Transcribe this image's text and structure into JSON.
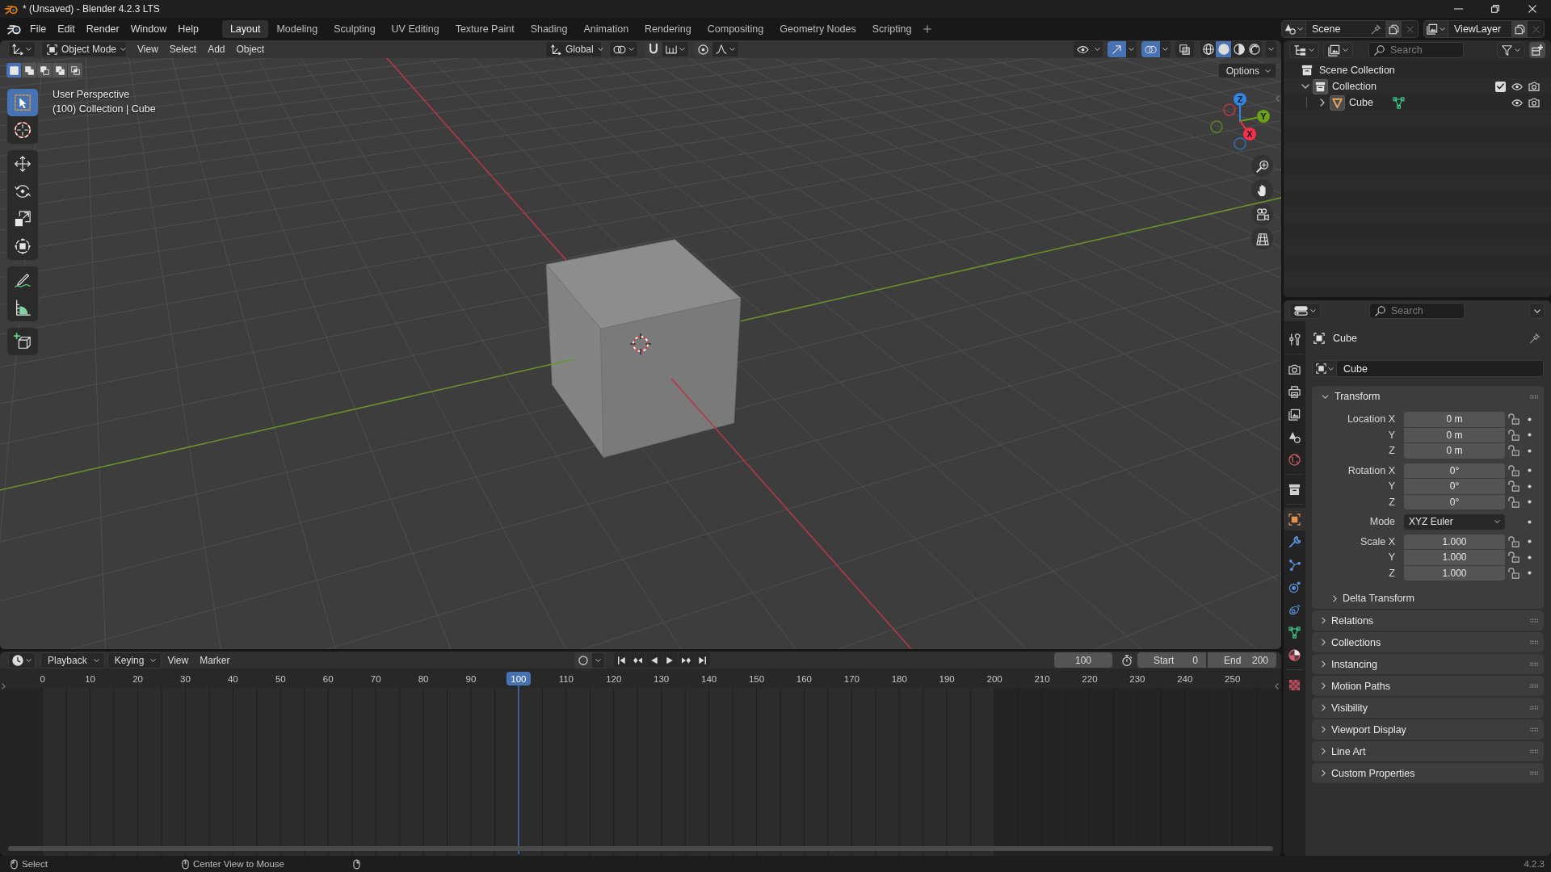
{
  "window": {
    "title": "* (Unsaved) - Blender 4.2.3 LTS"
  },
  "menu": [
    "File",
    "Edit",
    "Render",
    "Window",
    "Help"
  ],
  "workspaces": [
    {
      "label": "Layout",
      "selected": true
    },
    {
      "label": "Modeling",
      "selected": false
    },
    {
      "label": "Sculpting",
      "selected": false
    },
    {
      "label": "UV Editing",
      "selected": false
    },
    {
      "label": "Texture Paint",
      "selected": false
    },
    {
      "label": "Shading",
      "selected": false
    },
    {
      "label": "Animation",
      "selected": false
    },
    {
      "label": "Rendering",
      "selected": false
    },
    {
      "label": "Compositing",
      "selected": false
    },
    {
      "label": "Geometry Nodes",
      "selected": false
    },
    {
      "label": "Scripting",
      "selected": false
    }
  ],
  "scene": {
    "name": "Scene"
  },
  "view_layer": {
    "name": "ViewLayer"
  },
  "viewport": {
    "mode": "Object Mode",
    "menus": [
      "View",
      "Select",
      "Add",
      "Object"
    ],
    "orientation": "Global",
    "toggles": [
      {
        "kind": "selectability",
        "on": false
      },
      {
        "kind": "gizmos",
        "on": true
      },
      {
        "kind": "overlays",
        "on": true
      },
      {
        "kind": "xray",
        "on": false
      }
    ],
    "shading": [
      {
        "kind": "wireframe",
        "selected": false
      },
      {
        "kind": "solid",
        "selected": true
      },
      {
        "kind": "material",
        "selected": false
      },
      {
        "kind": "rendered",
        "selected": false
      }
    ],
    "select_modes": [
      {
        "kind": "set",
        "selected": true
      },
      {
        "kind": "extend",
        "selected": false
      },
      {
        "kind": "subtract",
        "selected": false
      },
      {
        "kind": "invert",
        "selected": false
      },
      {
        "kind": "intersect",
        "selected": false
      }
    ],
    "options": "Options",
    "info": [
      "User Perspective",
      "(100) Collection | Cube"
    ],
    "tool_groups": [
      {
        "tools": [
          {
            "kind": "select_box",
            "selected": true
          },
          {
            "kind": "cursor",
            "selected": false
          }
        ]
      },
      {
        "tools": [
          {
            "kind": "move",
            "selected": false
          },
          {
            "kind": "rotate",
            "selected": false
          },
          {
            "kind": "scale",
            "selected": false
          },
          {
            "kind": "transform",
            "selected": false
          }
        ]
      },
      {
        "tools": [
          {
            "kind": "annotate",
            "selected": false
          },
          {
            "kind": "measure",
            "selected": false
          }
        ]
      },
      {
        "tools": [
          {
            "kind": "add_cube",
            "selected": false
          }
        ]
      }
    ],
    "gizmo_axes": [
      {
        "label": "Z",
        "color": "#2f85e3"
      },
      {
        "label": "Y",
        "color": "#6ca11c"
      },
      {
        "label": "X",
        "color": "#f5304e"
      }
    ]
  },
  "outliner": {
    "search": {
      "placeholder": "Search"
    },
    "tree": [
      {
        "kind": "scene_collection",
        "label": "Scene Collection",
        "children": [
          {
            "kind": "collection",
            "label": "Collection",
            "expanded": true,
            "checked": true,
            "visible": true,
            "children": [
              {
                "kind": "object",
                "label": "Cube",
                "expanded": false,
                "visible": true
              }
            ]
          }
        ]
      }
    ]
  },
  "properties": {
    "search": {
      "placeholder": "Search"
    },
    "tab_groups": [
      {
        "tabs": [
          {
            "kind": "tool",
            "selected": false
          }
        ]
      },
      {
        "tabs": [
          {
            "kind": "render",
            "selected": false
          },
          {
            "kind": "output",
            "selected": false
          },
          {
            "kind": "view_layer",
            "selected": false
          },
          {
            "kind": "scene",
            "selected": false
          },
          {
            "kind": "world",
            "selected": false
          }
        ]
      },
      {
        "tabs": [
          {
            "kind": "collection",
            "selected": false
          }
        ]
      },
      {
        "tabs": [
          {
            "kind": "object",
            "selected": true
          },
          {
            "kind": "modifiers",
            "selected": false
          },
          {
            "kind": "particles",
            "selected": false
          },
          {
            "kind": "physics",
            "selected": false
          },
          {
            "kind": "constraints",
            "selected": false
          },
          {
            "kind": "data",
            "selected": false
          },
          {
            "kind": "material",
            "selected": false
          }
        ]
      },
      {
        "tabs": [
          {
            "kind": "texture",
            "selected": false
          }
        ]
      }
    ],
    "context": "Cube",
    "datablock": "Cube",
    "transform": {
      "title": "Transform",
      "expanded": true,
      "groups": [
        {
          "rows": [
            {
              "kind": "number",
              "label": "Location X",
              "value": "0 m",
              "locked": false
            },
            {
              "kind": "number",
              "label": "Y",
              "value": "0 m",
              "locked": false
            },
            {
              "kind": "number",
              "label": "Z",
              "value": "0 m",
              "locked": false
            }
          ]
        },
        {
          "rows": [
            {
              "kind": "number",
              "label": "Rotation X",
              "value": "0°",
              "locked": false
            },
            {
              "kind": "number",
              "label": "Y",
              "value": "0°",
              "locked": false
            },
            {
              "kind": "number",
              "label": "Z",
              "value": "0°",
              "locked": false
            }
          ]
        },
        {
          "rows": [
            {
              "kind": "dropdown",
              "label": "Mode",
              "value": "XYZ Euler"
            }
          ]
        },
        {
          "rows": [
            {
              "kind": "number",
              "label": "Scale X",
              "value": "1.000",
              "locked": false
            },
            {
              "kind": "number",
              "label": "Y",
              "value": "1.000",
              "locked": false
            },
            {
              "kind": "number",
              "label": "Z",
              "value": "1.000",
              "locked": false
            }
          ]
        }
      ],
      "subpanels": [
        {
          "title": "Delta Transform",
          "expanded": false
        }
      ]
    },
    "panels": [
      {
        "title": "Relations",
        "expanded": false
      },
      {
        "title": "Collections",
        "expanded": false
      },
      {
        "title": "Instancing",
        "expanded": false
      },
      {
        "title": "Motion Paths",
        "expanded": false
      },
      {
        "title": "Visibility",
        "expanded": false
      },
      {
        "title": "Viewport Display",
        "expanded": false
      },
      {
        "title": "Line Art",
        "expanded": false
      },
      {
        "title": "Custom Properties",
        "expanded": false
      }
    ]
  },
  "timeline": {
    "menus": [
      {
        "label": "Playback",
        "kind": "dropdown"
      },
      {
        "label": "Keying",
        "kind": "dropdown"
      },
      {
        "label": "View",
        "kind": "menu"
      },
      {
        "label": "Marker",
        "kind": "menu"
      }
    ],
    "auto_keying": false,
    "frame": "100",
    "start_label": "Start",
    "start": "0",
    "end_label": "End",
    "end": "200",
    "ruler": [
      {
        "label": "0",
        "selected": false
      },
      {
        "label": "10",
        "selected": false
      },
      {
        "label": "20",
        "selected": false
      },
      {
        "label": "30",
        "selected": false
      },
      {
        "label": "40",
        "selected": false
      },
      {
        "label": "50",
        "selected": false
      },
      {
        "label": "60",
        "selected": false
      },
      {
        "label": "70",
        "selected": false
      },
      {
        "label": "80",
        "selected": false
      },
      {
        "label": "90",
        "selected": false
      },
      {
        "label": "100",
        "selected": true
      },
      {
        "label": "110",
        "selected": false
      },
      {
        "label": "120",
        "selected": false
      },
      {
        "label": "130",
        "selected": false
      },
      {
        "label": "140",
        "selected": false
      },
      {
        "label": "150",
        "selected": false
      },
      {
        "label": "160",
        "selected": false
      },
      {
        "label": "170",
        "selected": false
      },
      {
        "label": "180",
        "selected": false
      },
      {
        "label": "190",
        "selected": false
      },
      {
        "label": "200",
        "selected": false
      },
      {
        "label": "210",
        "selected": false
      },
      {
        "label": "220",
        "selected": false
      },
      {
        "label": "230",
        "selected": false
      },
      {
        "label": "240",
        "selected": false
      },
      {
        "label": "250",
        "selected": false
      }
    ]
  },
  "status_bar": {
    "hints": [
      "Select",
      "Center View to Mouse"
    ],
    "version": "4.2.3"
  }
}
